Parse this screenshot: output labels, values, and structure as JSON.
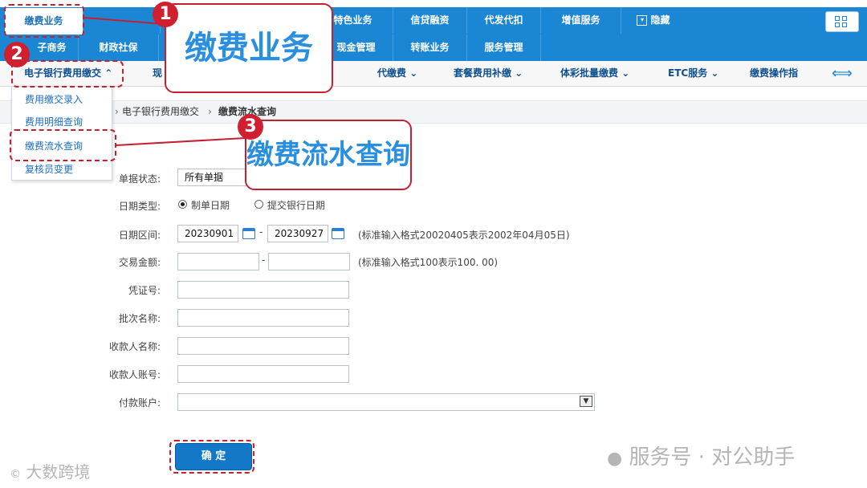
{
  "top_nav": {
    "row1": [
      "缴费业务",
      "",
      "特色业务",
      "信贷融资",
      "代发代扣",
      "增值服务"
    ],
    "hide_label": "隐藏",
    "row2": [
      "子商务",
      "财政社保",
      "现金管理",
      "转账业务",
      "服务管理"
    ]
  },
  "sub_nav": [
    "电子银行费用缴交",
    "现",
    "代缴费",
    "套餐费用补缴",
    "体彩批量缴费",
    "ETC服务",
    "缴费操作指"
  ],
  "dropdown": [
    "费用缴交录入",
    "费用明细查询",
    "缴费流水查询",
    "复核员变更"
  ],
  "breadcrumb": {
    "item1": "电子银行费用缴交",
    "item2": "缴费流水查询"
  },
  "form": {
    "status_label": "单据状态:",
    "status_value": "所有单据",
    "date_type_label": "日期类型:",
    "date_type_opt1": "制单日期",
    "date_type_opt2": "提交银行日期",
    "date_range_label": "日期区间:",
    "date_from": "20230901",
    "date_to": "20230927",
    "date_hint": "(标准输入格式20020405表示2002年04月05日)",
    "amount_label": "交易金额:",
    "amount_hint": "(标准输入格式100表示100. 00)",
    "voucher_label": "凭证号:",
    "batch_label": "批次名称:",
    "payee_name_label": "收款人名称:",
    "payee_account_label": "收款人账号:",
    "pay_account_label": "付款账户:",
    "dash": "-",
    "ok_button": "确 定"
  },
  "annotations": {
    "n1": "1",
    "n2": "2",
    "n3": "3",
    "callout1": "缴费业务",
    "callout3": "缴费流水查询"
  },
  "watermarks": {
    "left": "大数跨境",
    "right": "服务号 · 对公助手"
  }
}
